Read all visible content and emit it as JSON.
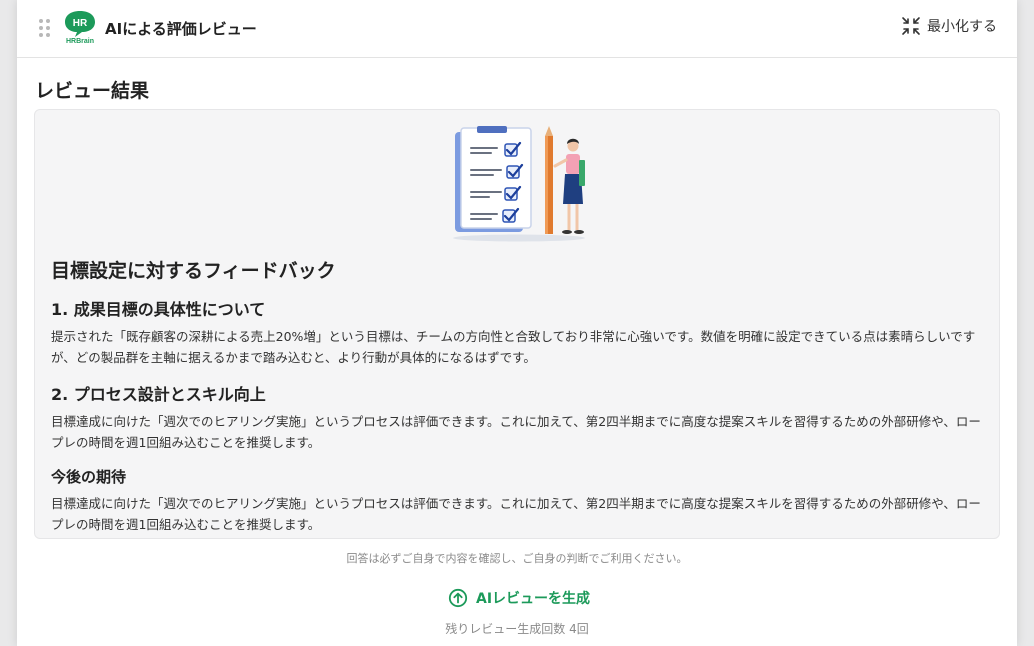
{
  "header": {
    "app_title": "AIによる評価レビュー",
    "logo_text_top": "HR",
    "logo_text_bottom": "HRBrain",
    "minimize_label": "最小化する"
  },
  "main": {
    "section_title": "レビュー結果",
    "feedback_title": "目標設定に対するフィードバック",
    "blocks": [
      {
        "heading": "1. 成果目標の具体性について",
        "body": "提示された「既存顧客の深耕による売上20%増」という目標は、チームの方向性と合致しており非常に心強いです。数値を明確に設定できている点は素晴らしいですが、どの製品群を主軸に据えるかまで踏み込むと、より行動が具体的になるはずです。"
      },
      {
        "heading": "2. プロセス設計とスキル向上",
        "body": "目標達成に向けた「週次でのヒアリング実施」というプロセスは評価できます。これに加えて、第2四半期までに高度な提案スキルを習得するための外部研修や、ロープレの時間を週1回組み込むことを推奨します。"
      },
      {
        "heading": "今後の期待",
        "body": "目標達成に向けた「週次でのヒアリング実施」というプロセスは評価できます。これに加えて、第2四半期までに高度な提案スキルを習得するための外部研修や、ロープレの時間を週1回組み込むことを推奨します。"
      }
    ]
  },
  "footer": {
    "disclaimer": "回答は必ずご自身で内容を確認し、ご自身の判断でご利用ください。",
    "generate_label": "AIレビューを生成",
    "remaining": "残りレビュー生成回数 4回"
  },
  "colors": {
    "accent_green": "#1c9a5a",
    "card_bg": "#f5f5f6"
  }
}
